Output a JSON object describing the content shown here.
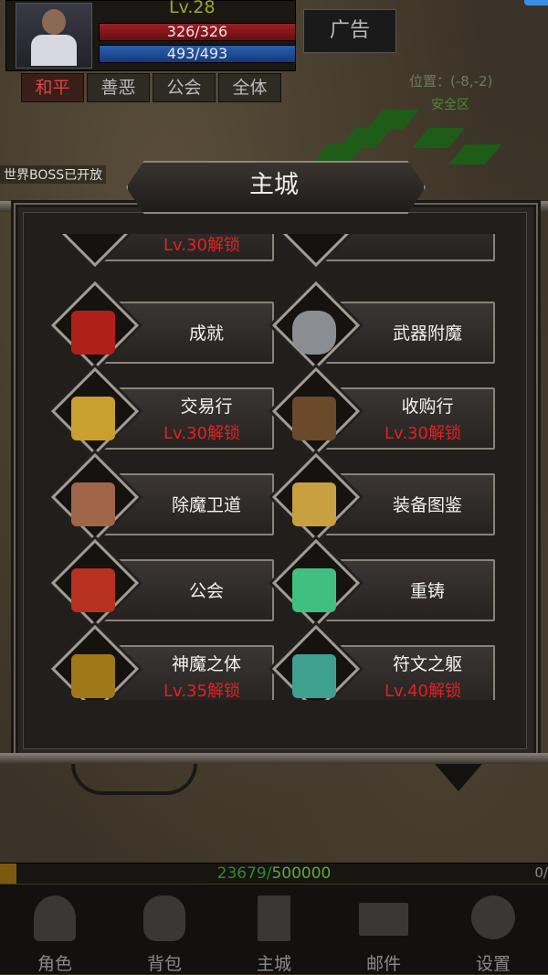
{
  "player": {
    "level": "Lv.28",
    "hp": "326/326",
    "mp": "493/493"
  },
  "ad_button": "广告",
  "modes": [
    "和平",
    "善恶",
    "公会",
    "全体"
  ],
  "position_text": "位置：(-8,-2)",
  "safe_zone": "安全区",
  "ticker": "世界BOSS已开放",
  "dialog": {
    "title": "主城",
    "items": [
      {
        "name": "",
        "lock": "Lv.30解锁",
        "col": 0
      },
      {
        "name": "",
        "lock": "",
        "col": 1
      },
      {
        "name": "成就",
        "lock": "",
        "icon": "scroll-icon",
        "color": "#b0201a"
      },
      {
        "name": "武器附魔",
        "lock": "",
        "icon": "rune-stone-icon",
        "color": "#8a8d92"
      },
      {
        "name": "交易行",
        "lock": "Lv.30解锁",
        "icon": "gold-ingot-icon",
        "color": "#c9a030"
      },
      {
        "name": "收购行",
        "lock": "Lv.30解锁",
        "icon": "treasure-chest-icon",
        "color": "#6a4a2a"
      },
      {
        "name": "除魔卫道",
        "lock": "",
        "icon": "bundle-icon",
        "color": "#a0664a"
      },
      {
        "name": "装备图鉴",
        "lock": "",
        "icon": "book-icon",
        "color": "#c8a040"
      },
      {
        "name": "公会",
        "lock": "",
        "icon": "guild-banner-icon",
        "color": "#b83020"
      },
      {
        "name": "重铸",
        "lock": "",
        "icon": "crystal-icon",
        "color": "#40c080"
      },
      {
        "name": "神魔之体",
        "lock": "Lv.35解锁",
        "icon": "pile-icon",
        "color": "#a07818"
      },
      {
        "name": "符文之躯",
        "lock": "Lv.40解锁",
        "icon": "gems-icon",
        "color": "#40a090"
      }
    ]
  },
  "xp": {
    "current": "23679",
    "separator": "/",
    "max": "500000"
  },
  "xp_right": "0/",
  "nav": [
    {
      "label": "角色",
      "icon": "character-icon"
    },
    {
      "label": "背包",
      "icon": "bag-icon"
    },
    {
      "label": "主城",
      "icon": "castle-icon"
    },
    {
      "label": "邮件",
      "icon": "mail-icon"
    },
    {
      "label": "设置",
      "icon": "gear-icon"
    }
  ]
}
